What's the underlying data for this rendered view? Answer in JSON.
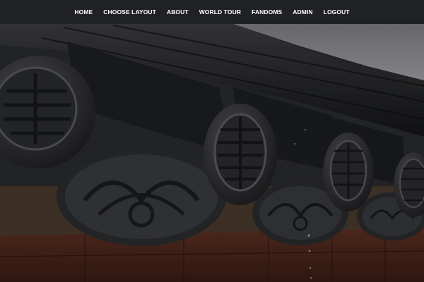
{
  "nav": {
    "items": [
      {
        "label": "HOME"
      },
      {
        "label": "CHOOSE LAYOUT"
      },
      {
        "label": "ABOUT"
      },
      {
        "label": "WORLD TOUR"
      },
      {
        "label": "FANDOMS"
      },
      {
        "label": "ADMIN"
      },
      {
        "label": "LOGOUT"
      }
    ]
  },
  "hero": {
    "image_subject": "roof-tile-eaves-photo"
  },
  "colors": {
    "navbar_bg": "#202124",
    "nav_text": "#ffffff",
    "sky": "#8d8e90",
    "brick": "#6b2e1e",
    "wall": "#8a6a4f"
  }
}
